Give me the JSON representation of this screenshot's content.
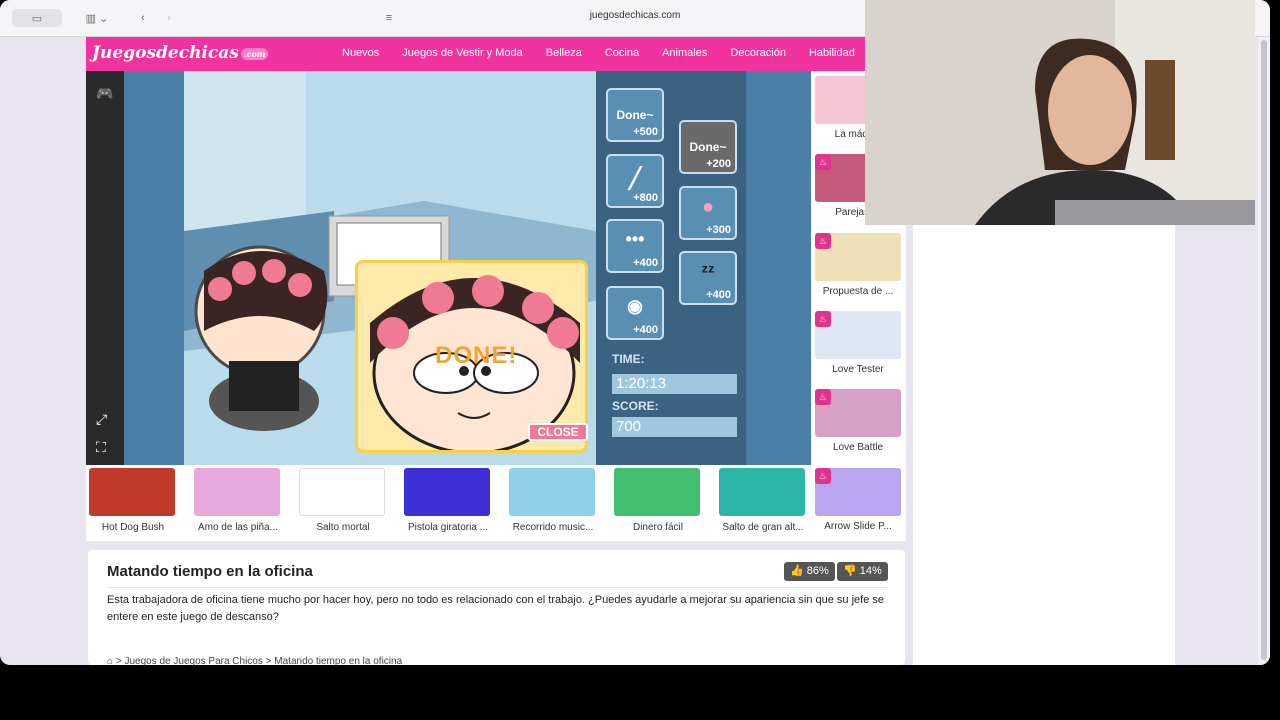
{
  "browser": {
    "url": "juegosdechicas.com"
  },
  "header": {
    "logo_text": "Juegosdechicas",
    "logo_suffix": ".com",
    "nav": [
      "Nuevos",
      "Juegos de Vestir y Moda",
      "Belleza",
      "Cocina",
      "Animales",
      "Decoración",
      "Habilidad"
    ]
  },
  "game": {
    "items": [
      {
        "label": "Done~",
        "points": "+500"
      },
      {
        "label": "Done~",
        "points": "+200"
      },
      {
        "label": "",
        "points": "+800"
      },
      {
        "label": "",
        "points": "+300"
      },
      {
        "label": "",
        "points": "+400"
      },
      {
        "label": "",
        "points": "+400"
      },
      {
        "label": "",
        "points": "+400"
      }
    ],
    "time_label": "TIME:",
    "time_value": "1:20:13",
    "score_label": "SCORE:",
    "score_value": "700",
    "done_text": "DONE!",
    "close_label": "CLOSE"
  },
  "related_games": [
    {
      "title": "Hot Dog Bush",
      "color": "#c0392b"
    },
    {
      "title": "Amo de las piña...",
      "color": "#e7a8e0"
    },
    {
      "title": "Salto mortal",
      "color": "#ffffff"
    },
    {
      "title": "Pistola giratoria ...",
      "color": "#3c2fd6"
    },
    {
      "title": "Recorrido music...",
      "color": "#8fd0e8"
    },
    {
      "title": "Dinero fácil",
      "color": "#3fbf6f"
    },
    {
      "title": "Salto de gran alt...",
      "color": "#2bb6a8"
    }
  ],
  "side_games": [
    {
      "title": "La máquin",
      "color": "#f6c5d3"
    },
    {
      "title": "Parejas re",
      "color": "#c65a7a"
    },
    {
      "title": "Propuesta de ...",
      "color": "#f0e0b8"
    },
    {
      "title": "Love Tester",
      "color": "#dfe7f2"
    },
    {
      "title": "Love Battle",
      "color": "#d9a0c5"
    },
    {
      "title": "Arrow Slide P...",
      "color": "#b9a6ef"
    }
  ],
  "description": {
    "title": "Matando tiempo en la oficina",
    "likes": "86%",
    "dislikes": "14%",
    "text": "Esta trabajadora de oficina tiene mucho por hacer hoy, pero no todo es relacionado con el trabajo. ¿Puedes ayudarle a mejorar su apariencia sin que su jefe se entere en este juego de descanso?",
    "breadcrumb": [
      ">",
      "Juegos de Juegos Para Chicos",
      ">",
      "Matando tiempo en la oficina"
    ]
  }
}
